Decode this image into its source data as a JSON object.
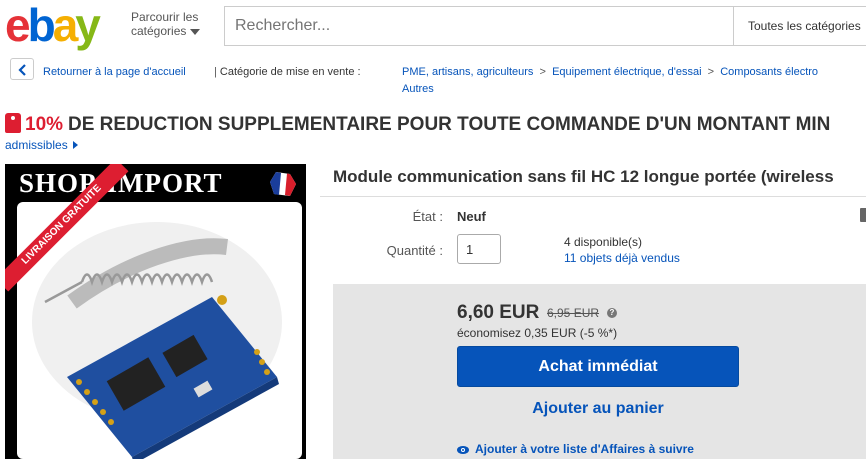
{
  "header": {
    "logo_letters": [
      "e",
      "b",
      "a",
      "y"
    ],
    "browse_line1": "Parcourir les",
    "browse_line2": "catégories",
    "search_placeholder": "Rechercher...",
    "search_category": "Toutes les catégories"
  },
  "breadcrumb": {
    "back": "Retourner à la page d'accueil",
    "category_label": "Catégorie de mise en vente :",
    "items": [
      "PME, artisans, agriculteurs",
      "Equipement électrique, d'essai",
      "Composants électro"
    ],
    "more": "Autres"
  },
  "promo": {
    "percent": "10%",
    "text": "DE REDUCTION SUPPLEMENTAIRE POUR TOUTE COMMANDE D'UN MONTANT MIN",
    "admissibles": "admissibles"
  },
  "image": {
    "shop_name": "SHOP-IMPORT",
    "ribbon": "LIVRAISON GRATUITE"
  },
  "product": {
    "title": "Module communication sans fil HC 12 longue portée (wireless",
    "state_label": "État :",
    "state_value": "Neuf",
    "qty_label": "Quantité :",
    "qty_value": "1",
    "available": "4 disponible(s)",
    "sold": "11 objets déjà vendus"
  },
  "buybox": {
    "price": "6,60 EUR",
    "old_price": "6,95 EUR",
    "help": "?",
    "savings": "économisez 0,35 EUR (-5 %*)",
    "buy_now": "Achat immédiat",
    "add_cart": "Ajouter au panier",
    "watch": "Ajouter à votre liste d'Affaires à suivre"
  },
  "colors": {
    "link": "#0654ba",
    "promo_red": "#dd1e31",
    "buy_button": "#0654ba",
    "buybox_bg": "#e5e5e5"
  }
}
